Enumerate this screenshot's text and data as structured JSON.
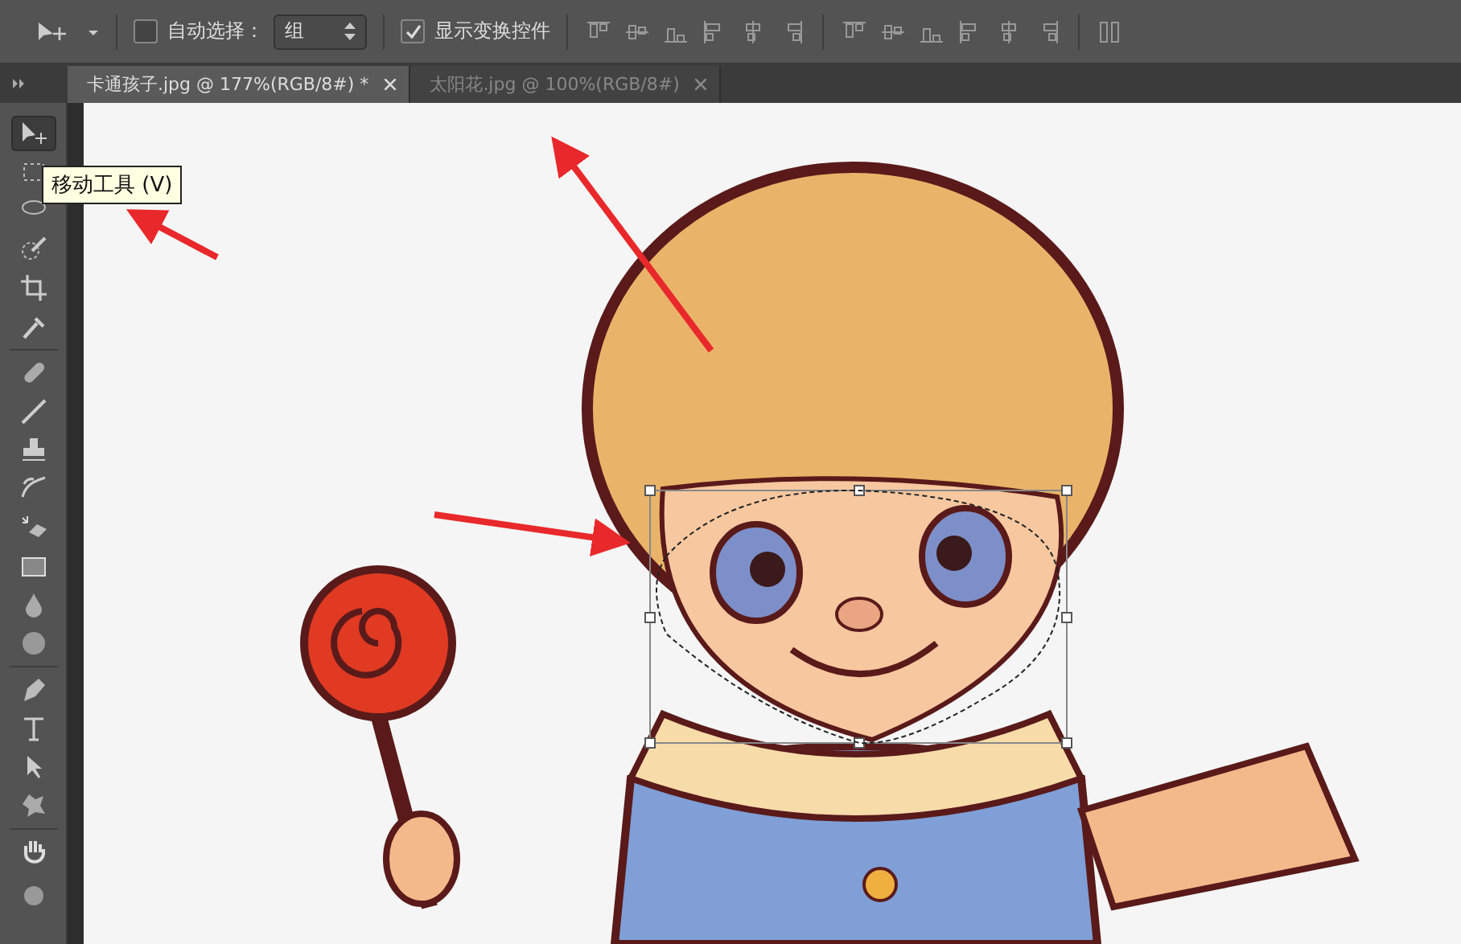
{
  "options_bar": {
    "auto_select": {
      "label": "自动选择：",
      "checked": false
    },
    "auto_select_target": {
      "value": "组"
    },
    "show_transform": {
      "label": "显示变换控件",
      "checked": true
    }
  },
  "tabs": [
    {
      "label": "卡通孩子.jpg @ 177%(RGB/8#) *",
      "selected": true
    },
    {
      "label": "太阳花.jpg @ 100%(RGB/8#)",
      "selected": false
    }
  ],
  "toolbox": {
    "tools": [
      {
        "kind": "move",
        "selected": true
      },
      {
        "kind": "marquee",
        "selected": false
      },
      {
        "kind": "lasso",
        "selected": false
      },
      {
        "kind": "quick",
        "selected": false
      },
      {
        "kind": "crop",
        "selected": false
      },
      {
        "kind": "eyedropper",
        "selected": false
      },
      {
        "kind": "heal",
        "selected": false
      },
      {
        "kind": "brush",
        "selected": false
      },
      {
        "kind": "stamp",
        "selected": false
      },
      {
        "kind": "history",
        "selected": false
      },
      {
        "kind": "eraser",
        "selected": false
      },
      {
        "kind": "gradient",
        "selected": false
      },
      {
        "kind": "drop",
        "selected": false
      },
      {
        "kind": "sponge",
        "selected": false
      },
      {
        "kind": "pen",
        "selected": false
      },
      {
        "kind": "type",
        "selected": false
      },
      {
        "kind": "pointer",
        "selected": false
      },
      {
        "kind": "shape",
        "selected": false
      },
      {
        "kind": "hand",
        "selected": false
      },
      {
        "kind": "zoom",
        "selected": false
      }
    ]
  },
  "tooltip": {
    "text": "移动工具 (V)"
  }
}
